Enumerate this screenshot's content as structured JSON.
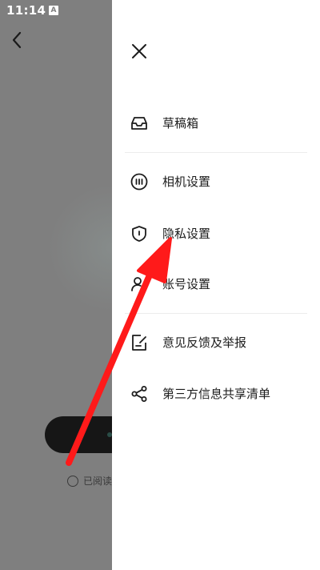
{
  "status_bar": {
    "time": "11:14",
    "badge": "A"
  },
  "background_page": {
    "agreement_text": "已阅读"
  },
  "drawer": {
    "menu": [
      {
        "icon": "inbox-icon",
        "label": "草稿箱"
      },
      {
        "icon": "camera-settings-icon",
        "label": "相机设置"
      },
      {
        "icon": "shield-icon",
        "label": "隐私设置"
      },
      {
        "icon": "account-icon",
        "label": "账号设置"
      },
      {
        "icon": "feedback-icon",
        "label": "意见反馈及举报"
      },
      {
        "icon": "share-icon",
        "label": "第三方信息共享清单"
      }
    ]
  },
  "annotation": {
    "color": "#ff1a1a"
  },
  "colors": {
    "overlay": "#7f7f7f",
    "drawer_bg": "#ffffff",
    "text": "#1c1c1c"
  }
}
